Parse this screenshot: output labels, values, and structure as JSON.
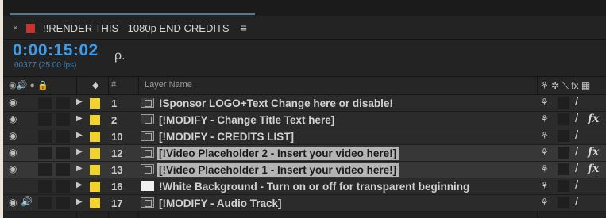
{
  "tab": {
    "close": "×",
    "title": "!!RENDER THIS - 1080p END CREDITS",
    "menu": "≡",
    "color": "#c9312c"
  },
  "time": {
    "timecode": "0:00:15:02",
    "frames": "00377 (25.00 fps)"
  },
  "search": {
    "icon": "ρ."
  },
  "header": {
    "switch_icons": "◉🔊 ● 🔒",
    "label_icon": "◆",
    "hash": "#",
    "layer_name": "Layer Name",
    "right_icons": "⚘ ✲ ⟍ fx ▦"
  },
  "layers": [
    {
      "num": "1",
      "name": "!Sponsor LOGO+Text Change here or disable!",
      "icon": "comp",
      "selected": false,
      "fx": false,
      "eye": "◉",
      "audio": ""
    },
    {
      "num": "2",
      "name": "[!MODIFY - Change Title Text  here]",
      "icon": "comp",
      "selected": false,
      "fx": true,
      "eye": "◉",
      "audio": ""
    },
    {
      "num": "10",
      "name": "[!MODIFY - CREDITS LIST]",
      "icon": "comp",
      "selected": false,
      "fx": false,
      "eye": "◉",
      "audio": ""
    },
    {
      "num": "12",
      "name": "[!Video Placeholder 2 - Insert your video here!]",
      "icon": "comp",
      "selected": true,
      "fx": true,
      "eye": "◉",
      "audio": ""
    },
    {
      "num": "13",
      "name": "[!Video Placeholder 1 - Insert your video here!]",
      "icon": "comp",
      "selected": true,
      "fx": true,
      "eye": "◉",
      "audio": ""
    },
    {
      "num": "16",
      "name": "!White Background - Turn on or off for transparent beginning",
      "icon": "white",
      "selected": false,
      "fx": false,
      "eye": "",
      "audio": ""
    },
    {
      "num": "17",
      "name": "[!MODIFY - Audio Track]",
      "icon": "comp",
      "selected": false,
      "fx": false,
      "eye": "◉",
      "audio": "🔊"
    }
  ],
  "colors": {
    "label": "#f2d32c",
    "timecode": "#3f9be6"
  }
}
